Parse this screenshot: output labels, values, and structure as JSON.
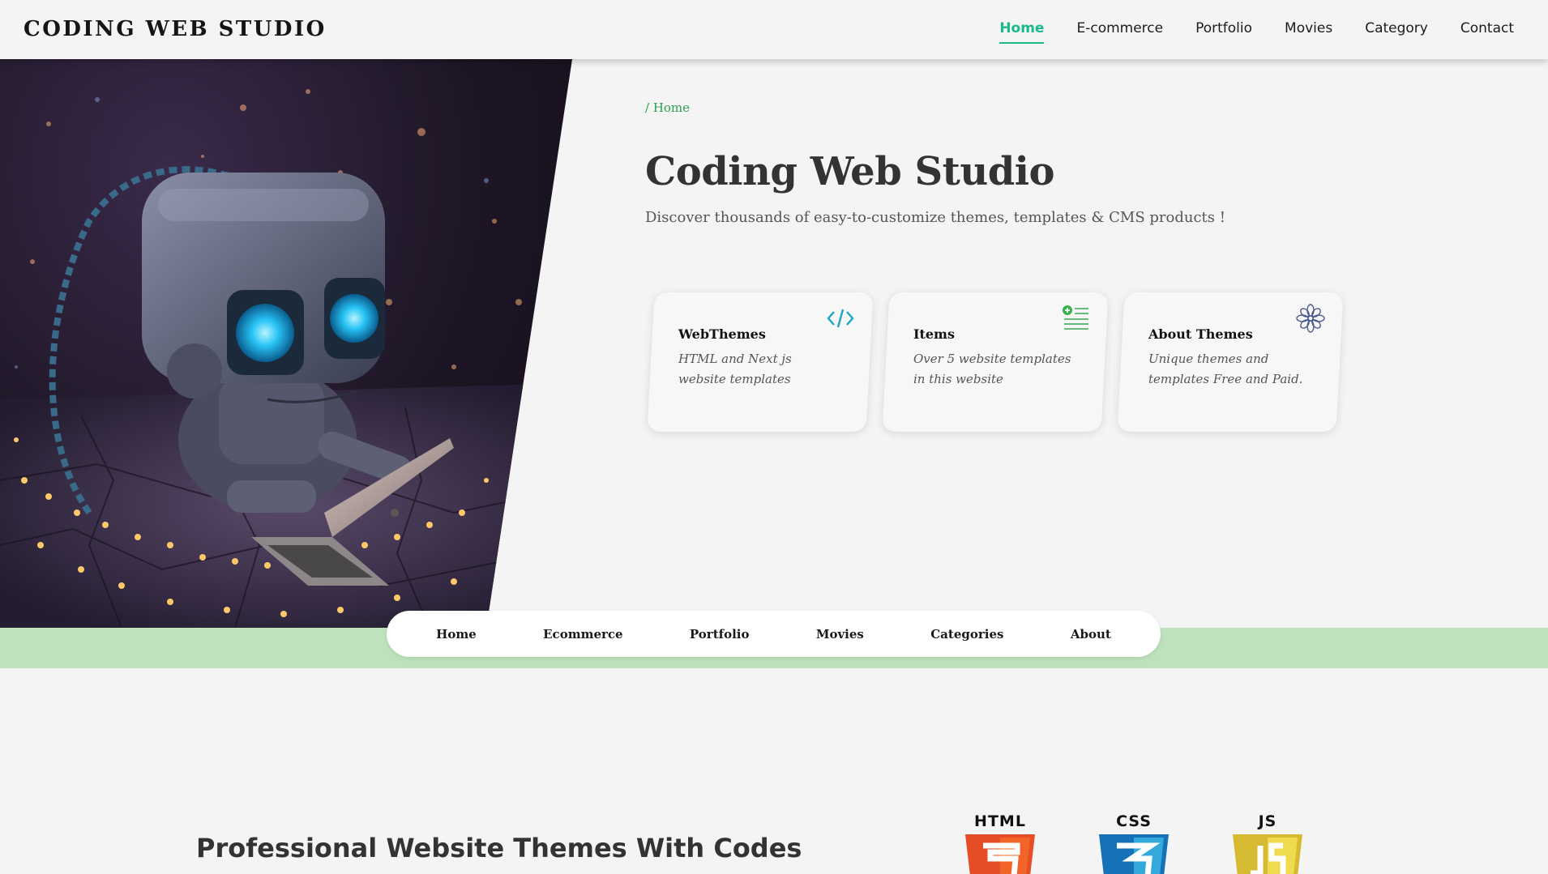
{
  "brand": "CODING WEB STUDIO",
  "nav": {
    "items": [
      "Home",
      "E-commerce",
      "Portfolio",
      "Movies",
      "Category",
      "Contact"
    ],
    "active": "Home"
  },
  "hero": {
    "breadcrumb": "/ Home",
    "title": "Coding Web Studio",
    "subtitle": "Discover thousands of easy-to-customize themes, templates & CMS products !"
  },
  "cards": [
    {
      "title": "WebThemes",
      "desc": "HTML and Next js website templates",
      "icon": "code-icon"
    },
    {
      "title": "Items",
      "desc": "Over 5 website templates in this website",
      "icon": "add-list-icon"
    },
    {
      "title": "About Themes",
      "desc": "Unique themes and templates Free and Paid.",
      "icon": "flower-icon"
    }
  ],
  "subnav": [
    "Home",
    "Ecommerce",
    "Portfolio",
    "Movies",
    "Categories",
    "About"
  ],
  "section": {
    "title": "Professional Website Themes With Codes",
    "tech": [
      "HTML",
      "CSS",
      "JS"
    ]
  },
  "colors": {
    "accent": "#19b98b",
    "band": "#bde2bd",
    "html": "#e44d26",
    "css": "#1572b6",
    "js": "#f0db4f"
  }
}
